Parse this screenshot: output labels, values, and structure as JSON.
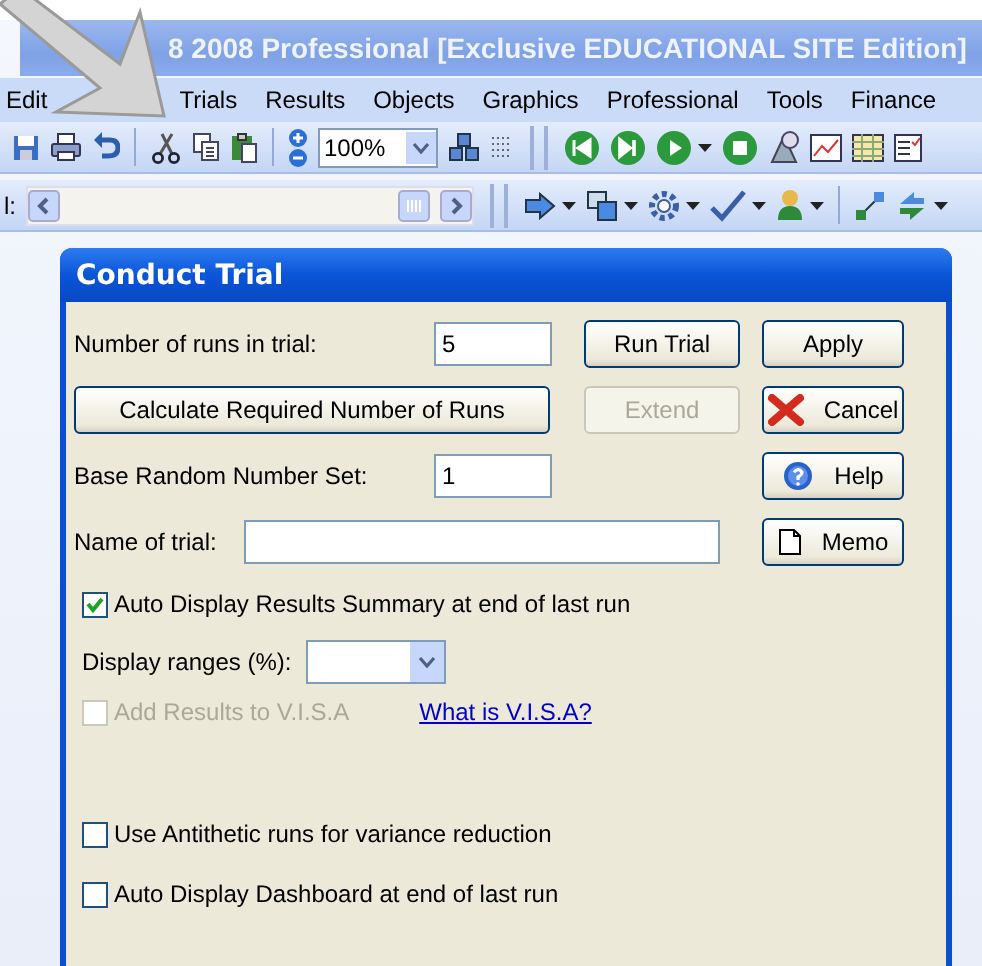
{
  "window": {
    "title": "8 2008 Professional [Exclusive EDUCATIONAL SITE Edition]"
  },
  "menu": [
    {
      "label": "Edit"
    },
    {
      "label": "Trials"
    },
    {
      "label": "Results"
    },
    {
      "label": "Objects"
    },
    {
      "label": "Graphics"
    },
    {
      "label": "Professional"
    },
    {
      "label": "Tools"
    },
    {
      "label": "Finance"
    }
  ],
  "toolbar": {
    "zoom": "100%",
    "scroll_label": "l:"
  },
  "dialog": {
    "title": "Conduct Trial",
    "fields": [
      {
        "label": "Number of runs in trial:",
        "value": "5"
      },
      {
        "label": "Base Random Number Set:",
        "value": "1"
      },
      {
        "label": "Name of trial:"
      }
    ],
    "buttons": [
      {
        "label": "Run Trial",
        "kind": "plain",
        "disabled": false
      },
      {
        "label": "Apply",
        "kind": "plain",
        "disabled": false
      },
      {
        "label": "Calculate Required Number of Runs",
        "kind": "plain",
        "disabled": false
      },
      {
        "label": "Extend",
        "kind": "plain",
        "disabled": true
      },
      {
        "label": "Cancel",
        "kind": "cancel",
        "disabled": false
      },
      {
        "label": "Help",
        "kind": "help",
        "disabled": false
      },
      {
        "label": "Memo",
        "kind": "memo",
        "disabled": false
      }
    ],
    "options": [
      {
        "label": "Auto Display Results Summary at end of last run",
        "checked": true,
        "disabled": false
      },
      {
        "label": "Add Results to V.I.S.A",
        "checked": false,
        "disabled": true
      },
      {
        "label": "Use Antithetic runs for variance reduction",
        "checked": false,
        "disabled": false
      },
      {
        "label": "Auto Display Dashboard at end of last run",
        "checked": false,
        "disabled": false
      }
    ],
    "ranges_label": "Display ranges (%):",
    "link": "What is V.I.S.A?"
  }
}
